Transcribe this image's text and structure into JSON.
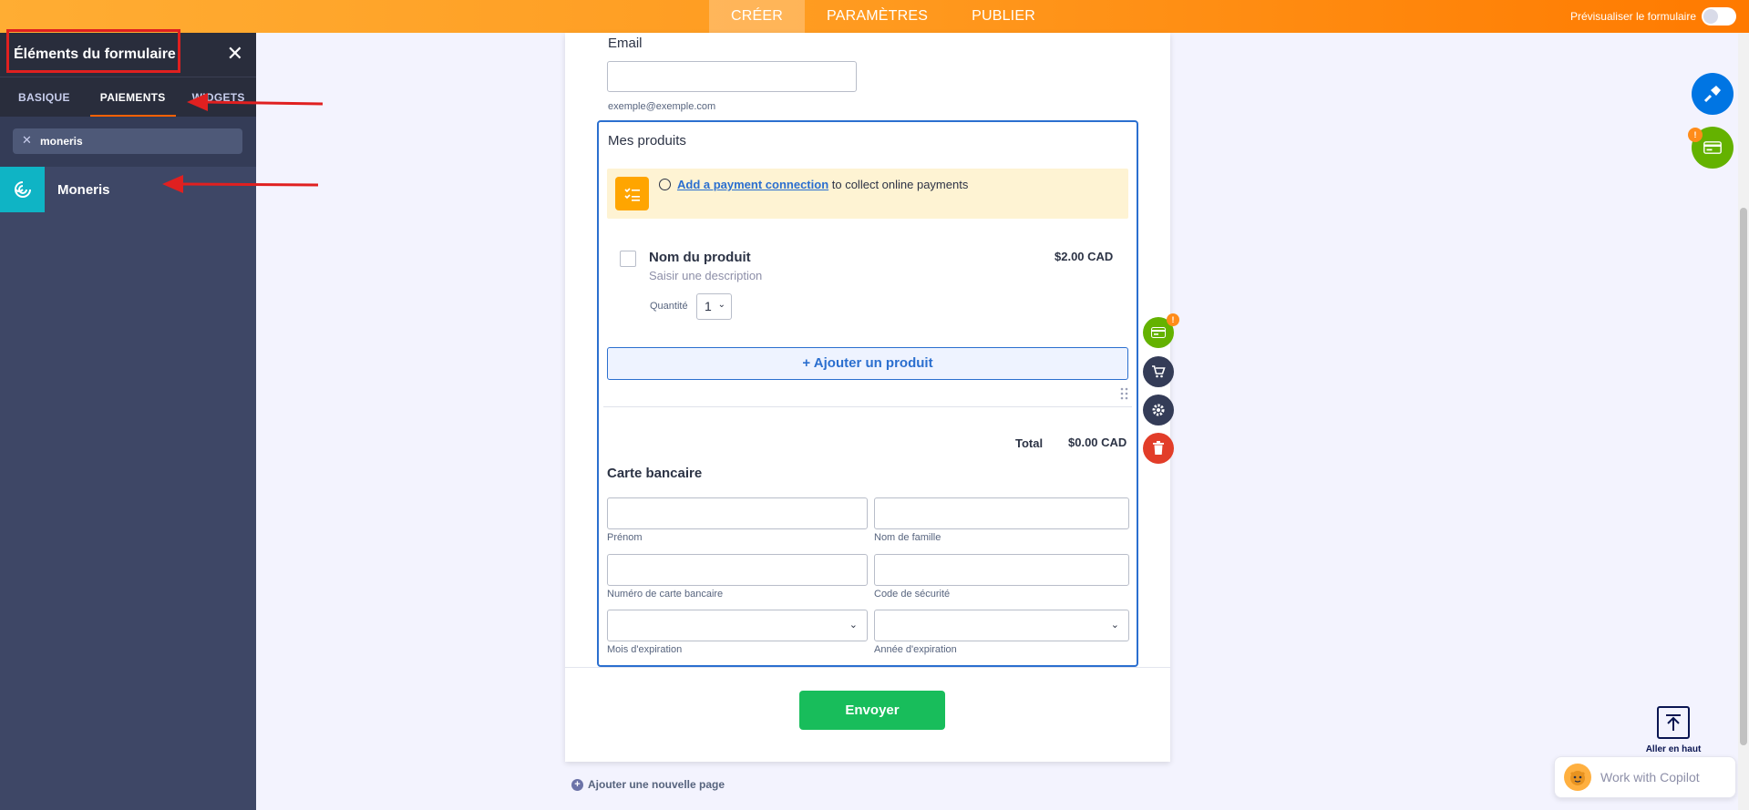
{
  "topbar": {
    "tabs": [
      "CRÉER",
      "PARAMÈTRES",
      "PUBLIER"
    ],
    "preview_label": "Prévisualiser le formulaire"
  },
  "sidebar": {
    "title": "Éléments du formulaire",
    "tabs": [
      "BASIQUE",
      "PAIEMENTS",
      "WIDGETS"
    ],
    "active_tab": "PAIEMENTS",
    "search_value": "moneris",
    "results": [
      {
        "label": "Moneris",
        "icon": "moneris-icon"
      }
    ]
  },
  "form": {
    "email": {
      "label": "Email",
      "sublabel": "exemple@exemple.com"
    },
    "products": {
      "title": "Mes produits",
      "warning_link": "Add a payment connection",
      "warning_text": " to collect online payments",
      "product_name": "Nom du produit",
      "product_desc": "Saisir une description",
      "product_price": "$2.00 CAD",
      "quantity_label": "Quantité",
      "quantity_value": "1",
      "add_product": "+ Ajouter un produit",
      "total_label": "Total",
      "total_value": "$0.00 CAD"
    },
    "card": {
      "title": "Carte bancaire",
      "first_name": "Prénom",
      "last_name": "Nom de famille",
      "card_number": "Numéro de carte bancaire",
      "security_code": "Code de sécurité",
      "exp_month": "Mois d'expiration",
      "exp_year": "Année d'expiration"
    },
    "submit_label": "Envoyer",
    "add_page": "Ajouter une nouvelle page"
  },
  "go_top_label": "Aller en haut",
  "copilot_label": "Work with Copilot",
  "colors": {
    "accent": "#ff7a00",
    "primary_blue": "#2b6fcf",
    "submit_green": "#18bd5b",
    "annotation_red": "#e02020"
  }
}
